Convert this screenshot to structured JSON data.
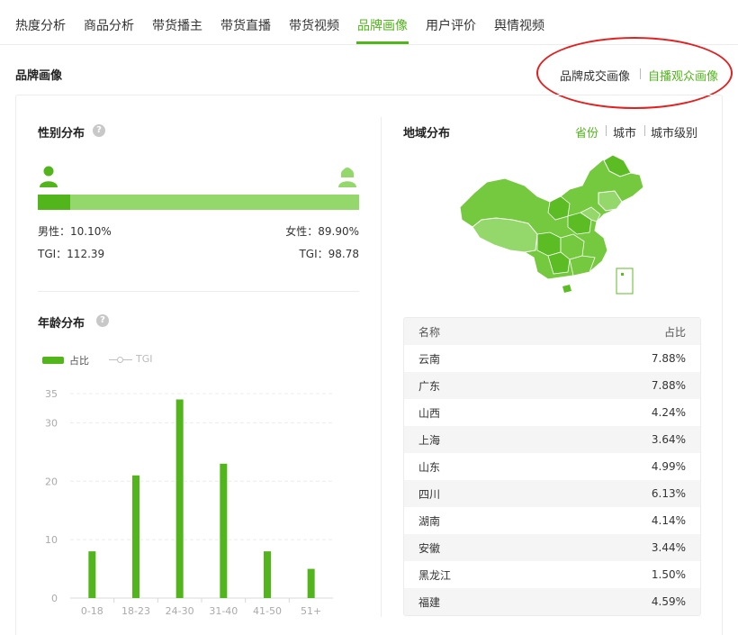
{
  "tabs": [
    {
      "label": "热度分析",
      "active": false
    },
    {
      "label": "商品分析",
      "active": false
    },
    {
      "label": "带货播主",
      "active": false
    },
    {
      "label": "带货直播",
      "active": false
    },
    {
      "label": "带货视频",
      "active": false
    },
    {
      "label": "品牌画像",
      "active": true
    },
    {
      "label": "用户评价",
      "active": false
    },
    {
      "label": "舆情视频",
      "active": false
    }
  ],
  "section": {
    "title": "品牌画像",
    "switch_deal": "品牌成交画像",
    "switch_audience": "自播观众画像",
    "selected": "自播观众画像"
  },
  "gender": {
    "title": "性别分布",
    "help": "?",
    "male_share": 0.101,
    "male_label": "男性：10.10%",
    "female_label": "女性：89.90%",
    "male_tgi": "TGI：112.39",
    "female_tgi": "TGI：98.78"
  },
  "age": {
    "title": "年龄分布",
    "help": "?",
    "legend_share": "占比",
    "legend_tgi": "TGI"
  },
  "region": {
    "title": "地域分布",
    "tab_province": "省份",
    "tab_city": "城市",
    "tab_city_level": "城市级别",
    "table_header": {
      "name": "名称",
      "share": "占比"
    },
    "rows": [
      {
        "name": "云南",
        "share": "7.88%"
      },
      {
        "name": "广东",
        "share": "7.88%"
      },
      {
        "name": "山西",
        "share": "4.24%"
      },
      {
        "name": "上海",
        "share": "3.64%"
      },
      {
        "name": "山东",
        "share": "4.99%"
      },
      {
        "name": "四川",
        "share": "6.13%"
      },
      {
        "name": "湖南",
        "share": "4.14%"
      },
      {
        "name": "安徽",
        "share": "3.44%"
      },
      {
        "name": "黑龙江",
        "share": "1.50%"
      },
      {
        "name": "福建",
        "share": "4.59%"
      }
    ]
  },
  "colors": {
    "accent": "#52b51c",
    "accent_light": "#94d86c",
    "annotation": "#e22020"
  },
  "chart_data": {
    "type": "bar",
    "title": "年龄分布",
    "categories": [
      "0-18",
      "18-23",
      "24-30",
      "31-40",
      "41-50",
      "51+"
    ],
    "series": [
      {
        "name": "占比",
        "values": [
          8,
          21,
          34,
          23,
          8,
          5
        ]
      }
    ],
    "yticks": [
      0,
      10,
      20,
      30,
      35
    ],
    "ylim": [
      0,
      35
    ],
    "grid": true,
    "legend": "top-left"
  }
}
